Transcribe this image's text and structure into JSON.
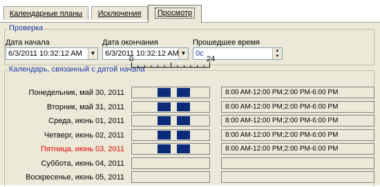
{
  "tabs": [
    {
      "label": "Календарные планы",
      "active": false
    },
    {
      "label": "Исключения",
      "active": false
    },
    {
      "label": "Просмотр",
      "active": true
    }
  ],
  "check_group": {
    "title": "Проверка",
    "start": {
      "label": "Дата начала",
      "value": "6/3/2011 10:32:12 AM"
    },
    "end": {
      "label": "Дата окончания",
      "value": "6/3/2011 10:32:12 AM"
    },
    "elapsed": {
      "label": "Прошедшее время",
      "value": "0с"
    }
  },
  "calendar_group": {
    "title": "Календарь, связанный с датой начала",
    "ruler": {
      "start": "0",
      "end": "24"
    },
    "days": [
      {
        "label": "Понедельник, май 30, 2011",
        "hours": "8:00 AM-12:00 PM;2:00 PM-6:00 PM",
        "highlight": false,
        "blocks": [
          [
            8,
            12
          ],
          [
            14,
            18
          ]
        ]
      },
      {
        "label": "Вторник, май 31, 2011",
        "hours": "8:00 AM-12:00 PM;2:00 PM-6:00 PM",
        "highlight": false,
        "blocks": [
          [
            8,
            12
          ],
          [
            14,
            18
          ]
        ]
      },
      {
        "label": "Среда, июнь 01, 2011",
        "hours": "8:00 AM-12:00 PM;2:00 PM-6:00 PM",
        "highlight": false,
        "blocks": [
          [
            8,
            12
          ],
          [
            14,
            18
          ]
        ]
      },
      {
        "label": "Четверг, июнь 02, 2011",
        "hours": "8:00 AM-12:00 PM;2:00 PM-6:00 PM",
        "highlight": false,
        "blocks": [
          [
            8,
            12
          ],
          [
            14,
            18
          ]
        ]
      },
      {
        "label": "Пятница, июнь 03, 2011",
        "hours": "8:00 AM-12:00 PM;2:00 PM-6:00 PM",
        "highlight": true,
        "blocks": [
          [
            8,
            12
          ],
          [
            14,
            18
          ]
        ]
      },
      {
        "label": "Суббота, июнь 04, 2011",
        "hours": "",
        "highlight": false,
        "blocks": []
      },
      {
        "label": "Воскресенье, июнь 05, 2011",
        "hours": "",
        "highlight": false,
        "blocks": []
      }
    ]
  },
  "colors": {
    "accent": "#1a39a8",
    "block": "#0a2a7a",
    "highlight": "#e00000"
  }
}
